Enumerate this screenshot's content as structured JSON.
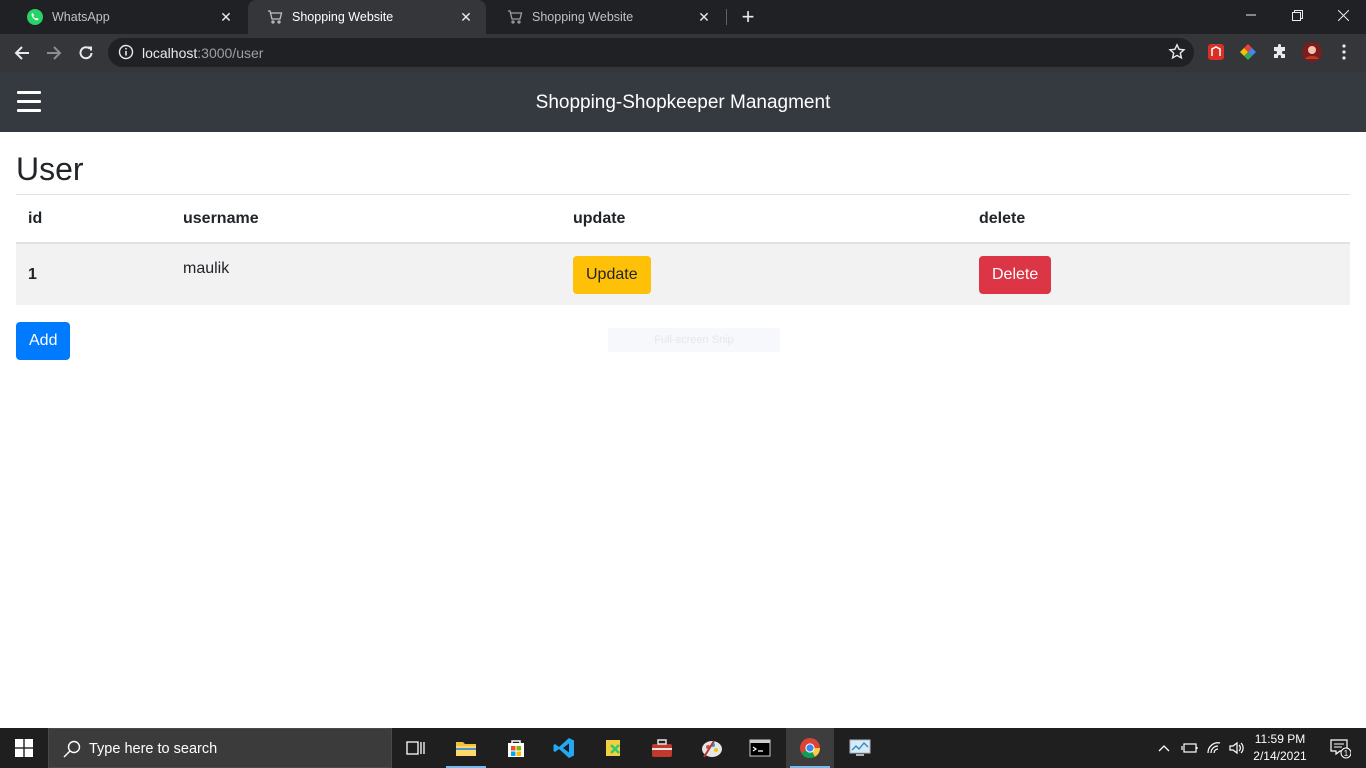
{
  "browser": {
    "tabs": [
      {
        "title": "WhatsApp",
        "icon": "whatsapp-icon",
        "active": false
      },
      {
        "title": "Shopping Website",
        "icon": "cart-icon",
        "active": true
      },
      {
        "title": "Shopping Website",
        "icon": "cart-icon",
        "active": false
      }
    ],
    "url_host": "localhost",
    "url_path": ":3000/user"
  },
  "app": {
    "title": "Shopping-Shopkeeper Managment"
  },
  "page": {
    "heading": "User",
    "table": {
      "headers": [
        "id",
        "username",
        "update",
        "delete"
      ],
      "rows": [
        {
          "id": "1",
          "username": "maulik",
          "update_label": "Update",
          "delete_label": "Delete"
        }
      ]
    },
    "add_label": "Add"
  },
  "overlay": {
    "snip_text": "Full-screen Snip"
  },
  "taskbar": {
    "search_placeholder": "Type here to search",
    "time": "11:59 PM",
    "date": "2/14/2021",
    "notification_count": "1"
  },
  "colors": {
    "navbar": "#343a40",
    "warning": "#ffc107",
    "danger": "#dc3545",
    "primary": "#007bff"
  }
}
